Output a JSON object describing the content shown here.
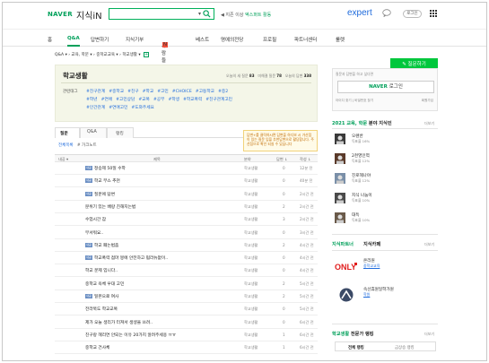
{
  "header": {
    "logo": "NAVER",
    "service": "지식iN",
    "search_value": "",
    "notice_prefix": "◀ 지존 이상 ",
    "notice_highlight": "엑스퍼트 활동",
    "expert": "expert",
    "login": "로그인"
  },
  "nav": {
    "items": [
      "홈",
      "Q&A",
      "답변하기",
      "지식기부",
      "사람들",
      "베스트",
      "명예의전당",
      "프로필",
      "파트너센터",
      "룰렛"
    ],
    "ask": "✎ 질문하기"
  },
  "breadcrumb": {
    "items": [
      "Q&A",
      "교육, 학문",
      "중학교교육",
      "학교생활"
    ]
  },
  "category": {
    "title": "학교생활",
    "stats": [
      {
        "label": "오늘의 새 질문",
        "value": "83"
      },
      {
        "label": "미해결 질문",
        "value": "78"
      },
      {
        "label": "오늘의 답변",
        "value": "338"
      }
    ],
    "tag_label": "관련태그",
    "tags": [
      "#친구관계",
      "#중학교",
      "#친구",
      "#학교",
      "#고민",
      "#CHOICE",
      "#고등학교",
      "#중2",
      "#학년",
      "#연애",
      "#고민상담",
      "#교복",
      "#공부",
      "#학생",
      "#학교폭력",
      "#친구관계고민",
      "#인간관계",
      "#연애고민",
      "#도와주세요"
    ]
  },
  "tabs": {
    "questions": "질문",
    "qna": "Q&A",
    "best": "랭킹"
  },
  "tooltip": "답변+를 클릭하시면 답변을 하디보 시 가산점이 있는 질문 입을 추천답변으로 활당합니다. 주선접으로 확인 되실 수 있습니다",
  "subtabs": {
    "all": "전체목록",
    "hot": "# 가크노트"
  },
  "table": {
    "headers": {
      "title": "제목",
      "category": "분야",
      "answers": "답변 ↓",
      "date": "작성 ↓"
    },
    "rows": [
      {
        "badge": "내공",
        "title": "정승제 50일 수학",
        "category": "학교생활",
        "answers": "0",
        "date": "12분 전"
      },
      {
        "badge": "내공",
        "title": "학교 부스 추천",
        "category": "학교생활",
        "answers": "0",
        "date": "40분 전"
      },
      {
        "badge": "내공",
        "title": "질문에 답변",
        "category": "학교생활",
        "answers": "0",
        "date": "2시간 전"
      },
      {
        "badge": "",
        "title": "분위기 있는 배랑 친해지는법",
        "category": "학교생활",
        "answers": "2",
        "date": "2시간 전"
      },
      {
        "badge": "",
        "title": "수업시간 잠",
        "category": "학교생활",
        "answers": "3",
        "date": "2시간 전"
      },
      {
        "badge": "",
        "title": "무서워요..",
        "category": "학교생활",
        "answers": "0",
        "date": "3시간 전"
      },
      {
        "badge": "내공",
        "title": "학교 폐는법좀",
        "category": "학교생활",
        "answers": "2",
        "date": "4시간 전"
      },
      {
        "badge": "내공",
        "title": "학교폭력 점마 붕에 안전하고 펌라뉴없이..",
        "category": "학교생활",
        "answers": "0",
        "date": "4시간 전"
      },
      {
        "badge": "",
        "title": "학교 문제 입니다..",
        "category": "학교생활",
        "answers": "0",
        "date": "4시간 전"
      },
      {
        "badge": "",
        "title": "중학교 육체 우대 고민",
        "category": "학교생활",
        "answers": "2",
        "date": "5시간 전"
      },
      {
        "badge": "내공",
        "title": "일본으로 여사",
        "category": "학교생활",
        "answers": "2",
        "date": "5시간 전"
      },
      {
        "badge": "",
        "title": "전라북도 학교교복",
        "category": "학교생활",
        "answers": "0",
        "date": "5시간 전"
      },
      {
        "badge": "",
        "title": "제가 오늘 생리가 터져서 생생을 쓰려..",
        "category": "학교생활",
        "answers": "0",
        "date": "6시간 전"
      },
      {
        "badge": "",
        "title": "친구랑 헤리연 안되는 이유 20가지 알려주세용 ㅠㅠ",
        "category": "학교생활",
        "answers": "1",
        "date": "6시간 전"
      },
      {
        "badge": "",
        "title": "중학교 건사체",
        "category": "학교생활",
        "answers": "1",
        "date": "6시간 전"
      }
    ]
  },
  "sidebar": {
    "login_hint": "질문과 답변을 하고 싶다면",
    "login_brand": "NAVER",
    "login_label": "로그인",
    "find_links": "아이디 찾기 | 비밀번호 찾기",
    "join": "회원가입",
    "experts_title_prefix": "2021 교육, 학문",
    "experts_title_suffix": " 분야 지식인",
    "more": "더보기",
    "experts": [
      {
        "name": "오렌반",
        "rank": "득표율 16%"
      },
      {
        "name": "2천영인역",
        "rank": "득표율 12%"
      },
      {
        "name": "진로헤나야",
        "rank": "득표율 12%"
      },
      {
        "name": "지식 나눔이",
        "rank": "득표율 10%"
      },
      {
        "name": "대득",
        "rank": "득표율 10%"
      }
    ],
    "partners_tab1": "지식파트너",
    "partners_tab2": "지식카페",
    "partners": [
      {
        "name": "온리원",
        "category": "중학교교육"
      },
      {
        "name": "속선휴원일학가원",
        "category": "학원"
      }
    ],
    "rank_title_prefix": "학교생활",
    "rank_title_suffix": " 전문가 랭킹",
    "rank_tabs": [
      "전체 랭킹",
      "금상승 랭킹"
    ],
    "brand_color": "#00a05a"
  }
}
